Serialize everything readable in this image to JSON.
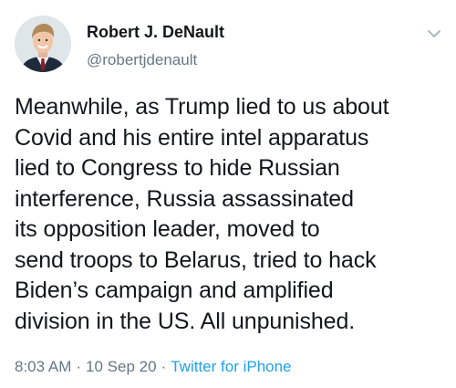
{
  "author": {
    "display_name": "Robert J. DeNault",
    "handle": "@robertjdenault"
  },
  "tweet": {
    "lines": [
      "Meanwhile, as Trump lied to us about",
      "Covid and his entire intel apparatus",
      "lied to Congress to hide Russian",
      "interference, Russia assassinated",
      "its opposition leader, moved to",
      "send troops to Belarus, tried to hack",
      "Biden’s campaign and amplified",
      "division in the US. All unpunished."
    ],
    "time": "8:03 AM",
    "separator": "·",
    "date": "10 Sep 20",
    "source": "Twitter for iPhone"
  },
  "icons": {
    "menu": "chevron-down-icon",
    "avatar": "profile-photo"
  },
  "colors": {
    "text": "#14171a",
    "secondary": "#657786",
    "link": "#1da1f2",
    "caret": "#aab8c2"
  }
}
